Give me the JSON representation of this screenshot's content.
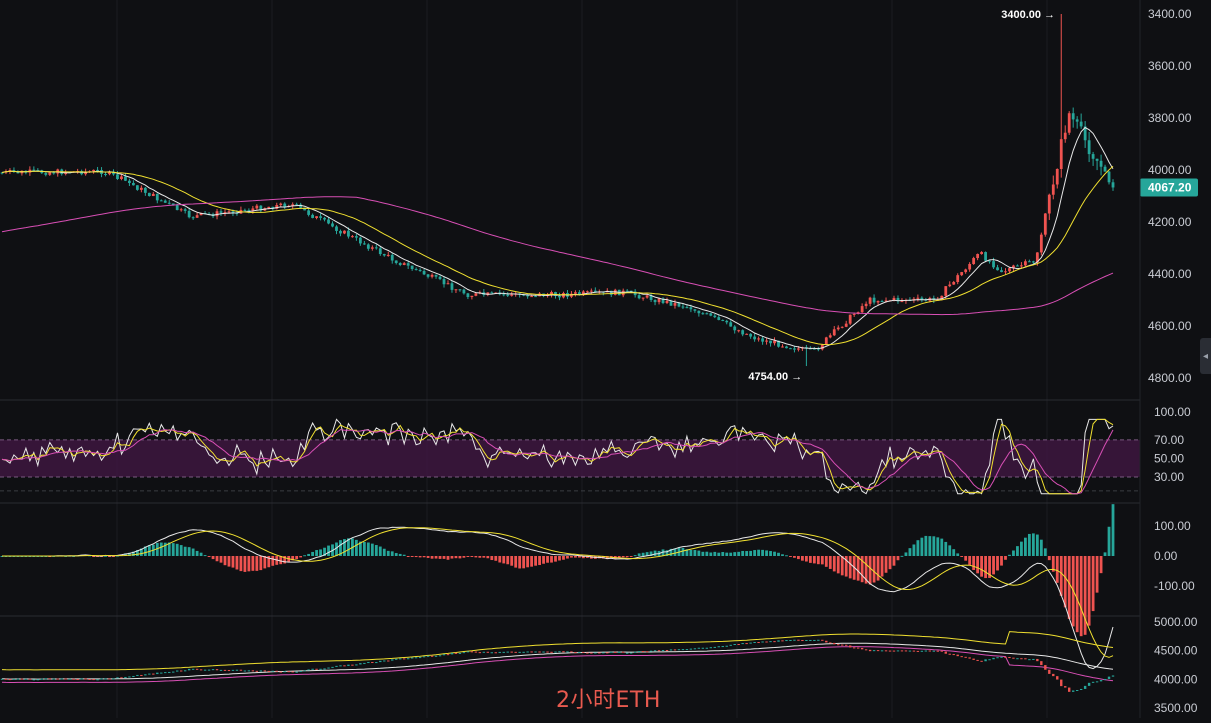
{
  "chart_label": "2小时ETH",
  "collapse_icon": "chevron-left-icon",
  "colors": {
    "background": "#0f1013",
    "grid": "#1b1d22",
    "up": "#26a69a",
    "down": "#ef5350",
    "ma_fast": "#e8e8e8",
    "ma_mid": "#f0e030",
    "ma_slow": "#d84fb5",
    "rsi_band": "#3d1640"
  },
  "chart_data": [
    {
      "type": "candlestick",
      "ylim": [
        3400,
        4800
      ],
      "yticks": [
        "4800.00",
        "4600.00",
        "4400.00",
        "4200.00",
        "4000.00",
        "3800.00",
        "3600.00",
        "3400.00"
      ],
      "current_price": "4067.20",
      "annotations": [
        {
          "label": "4754.00",
          "arrow": "→",
          "value": 4754
        },
        {
          "label": "3400.00",
          "arrow": "→",
          "value": 3400
        }
      ],
      "series_lines": [
        "ma_fast",
        "ma_mid",
        "ma_slow"
      ],
      "key_points": [
        {
          "t": 0,
          "price": 4010
        },
        {
          "t": 0.09,
          "price": 4005
        },
        {
          "t": 0.11,
          "price": 4040
        },
        {
          "t": 0.17,
          "price": 4180
        },
        {
          "t": 0.26,
          "price": 4130
        },
        {
          "t": 0.35,
          "price": 4340
        },
        {
          "t": 0.42,
          "price": 4480
        },
        {
          "t": 0.5,
          "price": 4480
        },
        {
          "t": 0.56,
          "price": 4470
        },
        {
          "t": 0.62,
          "price": 4530
        },
        {
          "t": 0.68,
          "price": 4650
        },
        {
          "t": 0.73,
          "price": 4700
        },
        {
          "t": 0.78,
          "price": 4500
        },
        {
          "t": 0.84,
          "price": 4500
        },
        {
          "t": 0.88,
          "price": 4320
        },
        {
          "t": 0.9,
          "price": 4390
        },
        {
          "t": 0.93,
          "price": 4350
        },
        {
          "t": 0.96,
          "price": 3780
        },
        {
          "t": 1.0,
          "price": 4067
        }
      ]
    },
    {
      "type": "line",
      "ylim": [
        0,
        100
      ],
      "yticks": [
        "100.00",
        "70.00",
        "50.00",
        "30.00"
      ],
      "band": [
        30,
        70
      ],
      "series_lines": [
        "rsi_fast",
        "rsi_mid",
        "rsi_slow"
      ],
      "current_value": 85
    },
    {
      "type": "bar",
      "ylim": [
        -150,
        150
      ],
      "yticks": [
        "100.00",
        "0.00",
        "-100.00"
      ],
      "series_lines": [
        "macd",
        "signal"
      ]
    },
    {
      "type": "line",
      "ylim": [
        3400,
        5100
      ],
      "yticks": [
        "5000.00",
        "4500.00",
        "4000.00",
        "3500.00"
      ],
      "series_lines": [
        "upper",
        "mid",
        "lower",
        "price"
      ]
    }
  ]
}
